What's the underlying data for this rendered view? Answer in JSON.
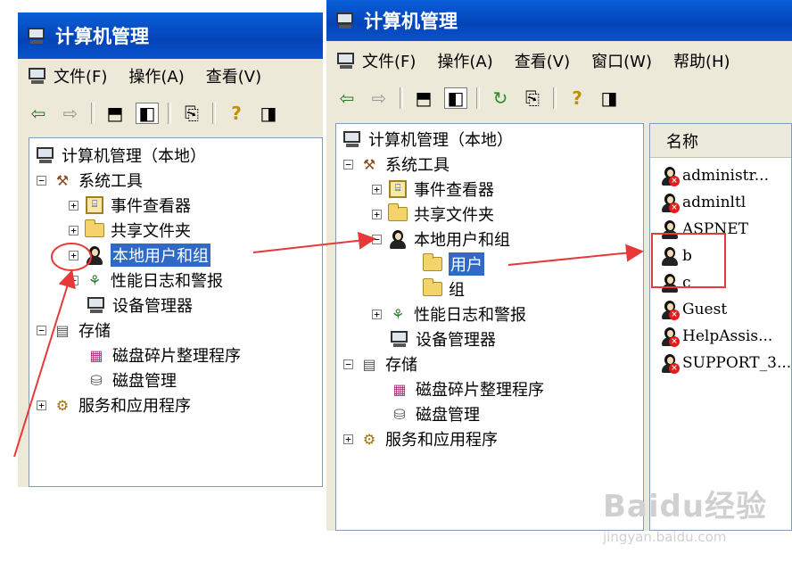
{
  "left_window": {
    "title": "计算机管理",
    "menu": [
      "文件(F)",
      "操作(A)",
      "查看(V)"
    ],
    "tree": [
      {
        "label": "计算机管理（本地）",
        "icon": "computer-icon",
        "expander": "",
        "selected": false
      },
      {
        "label": "系统工具",
        "icon": "tools-icon",
        "expander": "⊟",
        "selected": false
      },
      {
        "label": "事件查看器",
        "icon": "event-viewer-icon",
        "expander": "⊞",
        "selected": false
      },
      {
        "label": "共享文件夹",
        "icon": "shared-folder-icon",
        "expander": "⊞",
        "selected": false
      },
      {
        "label": "本地用户和组",
        "icon": "users-groups-icon",
        "expander": "⊞",
        "selected": true
      },
      {
        "label": "性能日志和警报",
        "icon": "performance-icon",
        "expander": "⊞",
        "selected": false
      },
      {
        "label": "设备管理器",
        "icon": "device-manager-icon",
        "expander": "",
        "selected": false
      },
      {
        "label": "存储",
        "icon": "storage-icon",
        "expander": "⊟",
        "selected": false
      },
      {
        "label": "磁盘碎片整理程序",
        "icon": "defrag-icon",
        "expander": "",
        "selected": false
      },
      {
        "label": "磁盘管理",
        "icon": "disk-management-icon",
        "expander": "",
        "selected": false
      },
      {
        "label": "服务和应用程序",
        "icon": "services-icon",
        "expander": "⊞",
        "selected": false
      }
    ]
  },
  "right_window": {
    "title": "计算机管理",
    "menu": [
      "文件(F)",
      "操作(A)",
      "查看(V)",
      "窗口(W)",
      "帮助(H)"
    ],
    "tree": [
      {
        "label": "计算机管理（本地）",
        "icon": "computer-icon",
        "expander": "",
        "selected": false
      },
      {
        "label": "系统工具",
        "icon": "tools-icon",
        "expander": "⊟",
        "selected": false
      },
      {
        "label": "事件查看器",
        "icon": "event-viewer-icon",
        "expander": "⊞",
        "selected": false
      },
      {
        "label": "共享文件夹",
        "icon": "shared-folder-icon",
        "expander": "⊞",
        "selected": false
      },
      {
        "label": "本地用户和组",
        "icon": "users-groups-icon",
        "expander": "⊟",
        "selected": false
      },
      {
        "label": "用户",
        "icon": "folder-open-icon",
        "expander": "",
        "selected": true
      },
      {
        "label": "组",
        "icon": "folder-icon",
        "expander": "",
        "selected": false
      },
      {
        "label": "性能日志和警报",
        "icon": "performance-icon",
        "expander": "⊞",
        "selected": false
      },
      {
        "label": "设备管理器",
        "icon": "device-manager-icon",
        "expander": "",
        "selected": false
      },
      {
        "label": "存储",
        "icon": "storage-icon",
        "expander": "⊟",
        "selected": false
      },
      {
        "label": "磁盘碎片整理程序",
        "icon": "defrag-icon",
        "expander": "",
        "selected": false
      },
      {
        "label": "磁盘管理",
        "icon": "disk-management-icon",
        "expander": "",
        "selected": false
      },
      {
        "label": "服务和应用程序",
        "icon": "services-icon",
        "expander": "⊞",
        "selected": false
      }
    ],
    "list_header": "名称",
    "users": [
      {
        "name": "administr...",
        "disabled": true
      },
      {
        "name": "adminltl",
        "disabled": true
      },
      {
        "name": "ASPNET",
        "disabled": false
      },
      {
        "name": "b",
        "disabled": false
      },
      {
        "name": "c",
        "disabled": false
      },
      {
        "name": "Guest",
        "disabled": true
      },
      {
        "name": "HelpAssis...",
        "disabled": true
      },
      {
        "name": "SUPPORT_3...",
        "disabled": true
      }
    ]
  },
  "watermark": {
    "brand": "Baidu经验",
    "url": "jingyan.baidu.com"
  },
  "colors": {
    "title_blue": "#0a54cc",
    "selection": "#316ac5",
    "annotation_red": "#e8393a"
  }
}
